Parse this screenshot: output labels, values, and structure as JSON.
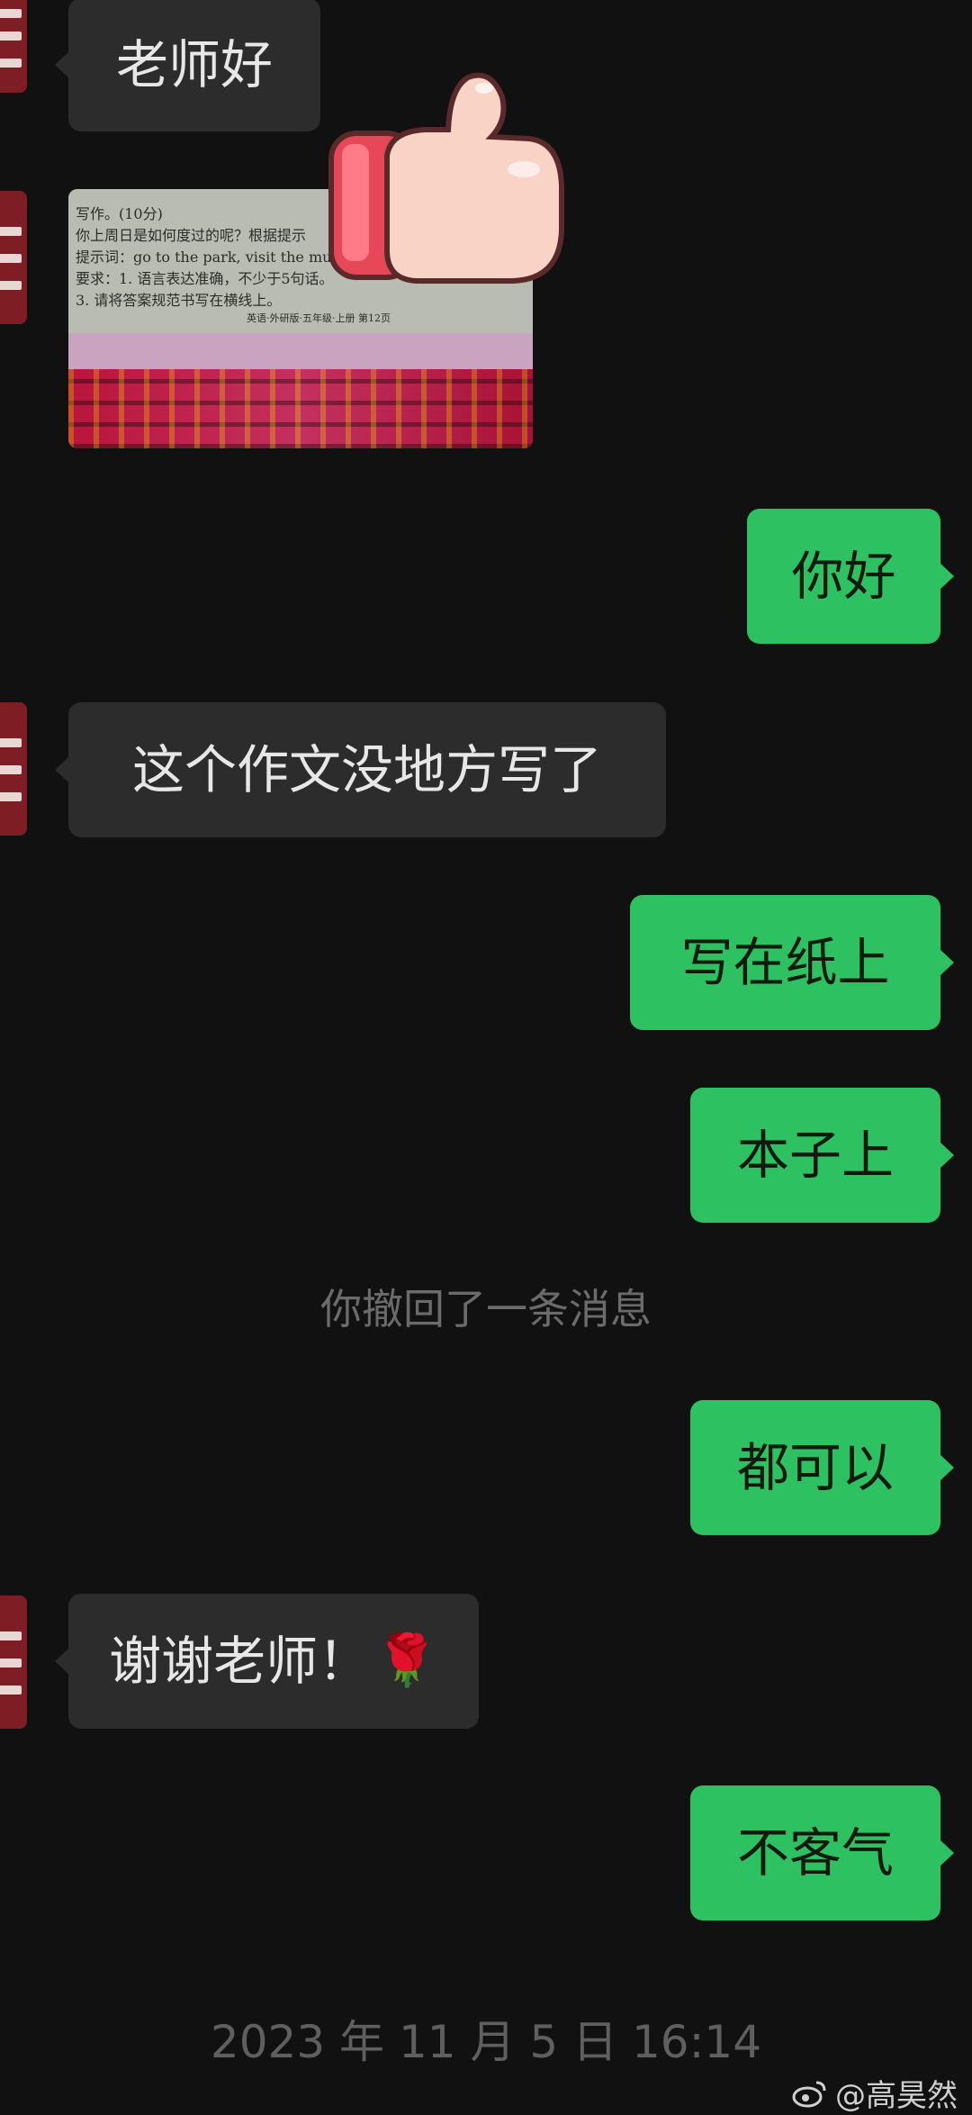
{
  "messages": [
    {
      "id": "m1",
      "side": "in",
      "text": "老师好"
    },
    {
      "id": "m2",
      "side": "in",
      "type": "image",
      "image_text": {
        "heading": "写作。(10分)",
        "line1": "你上周日是如何度过的呢？根据提示",
        "line2": "提示词：go to the park, visit the museum,",
        "line3": "要求：1. 语言表达准确，不少于5句话。",
        "line4": "3. 请将答案规范书写在横线上。",
        "footer": "英语·外研版·五年级·上册  第12页"
      }
    },
    {
      "id": "m3",
      "side": "out",
      "text": "你好"
    },
    {
      "id": "m4",
      "side": "in",
      "text": "这个作文没地方写了"
    },
    {
      "id": "m5",
      "side": "out",
      "text": "写在纸上"
    },
    {
      "id": "m6",
      "side": "out",
      "text": "本子上"
    },
    {
      "id": "m7",
      "side": "system",
      "text": "你撤回了一条消息"
    },
    {
      "id": "m8",
      "side": "out",
      "text": "都可以"
    },
    {
      "id": "m9",
      "side": "in",
      "text": "谢谢老师！",
      "emoji": "rose"
    },
    {
      "id": "m10",
      "side": "out",
      "text": "不客气"
    }
  ],
  "timestamp": "2023 年 11 月 5 日  16:14",
  "watermark": {
    "icon": "weibo-icon",
    "text": "@高昊然"
  },
  "colors": {
    "background": "#111111",
    "incoming_bubble": "#2c2c2c",
    "outgoing_bubble": "#2ec162",
    "system_text": "#6b6b6b"
  }
}
